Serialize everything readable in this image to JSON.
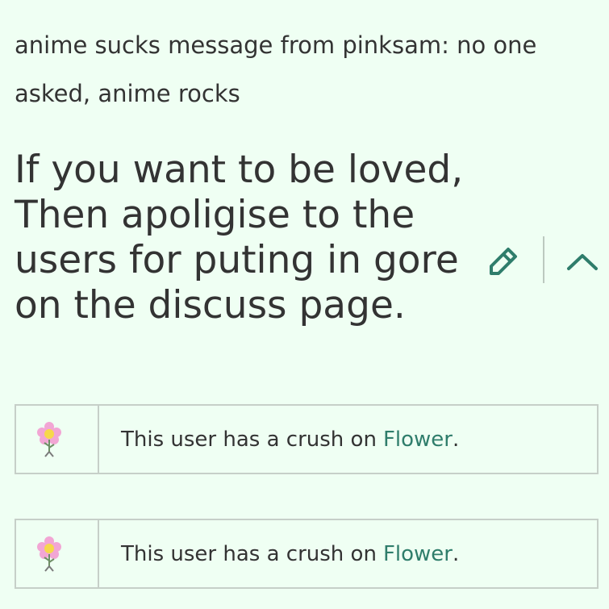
{
  "intro": {
    "text": "anime sucks message from pinksam: no one asked, anime rocks"
  },
  "section": {
    "heading": "If you want to be loved, Then apoligise to the users for puting in gore on the discuss page.",
    "edit_icon": "pencil-icon",
    "collapse_icon": "chevron-up-icon"
  },
  "userboxes": [
    {
      "icon": "flower-icon",
      "text": "This user has a crush on",
      "link": "Flower",
      "suffix": "."
    },
    {
      "icon": "flower-icon",
      "text": "This user has a crush on",
      "link": "Flower",
      "suffix": "."
    }
  ],
  "colors": {
    "background": "#effff3",
    "text": "#333333",
    "accent": "#2f7d6b",
    "border": "#c6cfc8"
  }
}
